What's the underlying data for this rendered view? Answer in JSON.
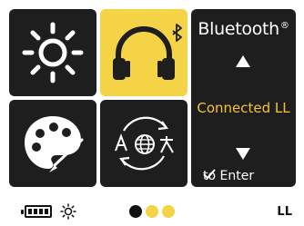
{
  "menu": {
    "tiles": [
      {
        "name": "brightness",
        "icon": "sun-icon",
        "selected": false
      },
      {
        "name": "audio",
        "icon": "headphones-icon",
        "badge_icon": "bluetooth-icon",
        "selected": true,
        "highlight_color": "#f4d347"
      },
      {
        "name": "theme",
        "icon": "palette-icon",
        "selected": false
      },
      {
        "name": "language",
        "icon": "language-globe-icon",
        "selected": false
      }
    ]
  },
  "panel": {
    "title": "Bluetooth",
    "title_mark": "®",
    "up_icon": "triangle-up-icon",
    "status": "Connected LL",
    "status_color": "#f4c430",
    "down_icon": "triangle-down-icon",
    "enter_icon": "checkmark-icon",
    "enter_hint": "to Enter"
  },
  "footer": {
    "battery_icon": "battery-full-icon",
    "battery_level": 1.0,
    "brightness_icon": "sun-small-icon",
    "page_dots": [
      {
        "color": "#111111",
        "active": true
      },
      {
        "color": "#f4d347",
        "active": false
      },
      {
        "color": "#f4d347",
        "active": false
      }
    ],
    "user_label": "LL"
  }
}
